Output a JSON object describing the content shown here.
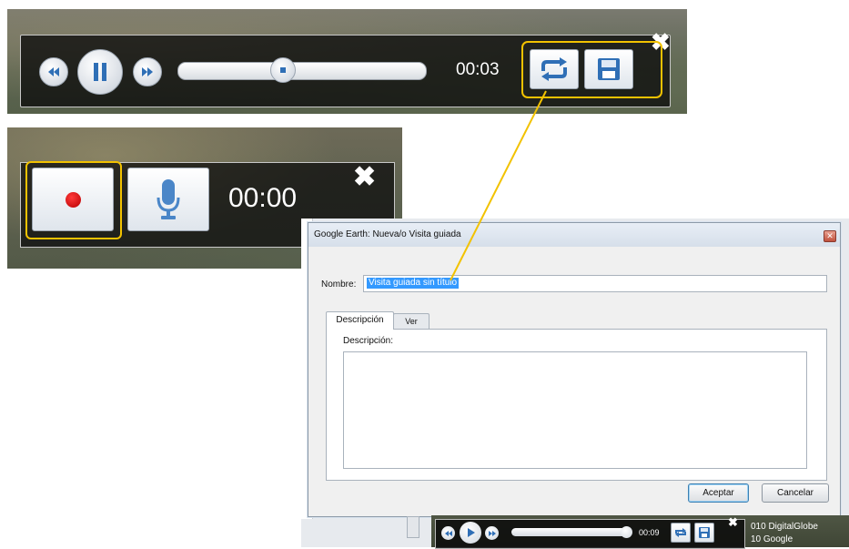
{
  "colors": {
    "highlight": "#f2c200",
    "accent_icon": "#2f6fb6",
    "record_red": "#c40000",
    "selection": "#3399ff"
  },
  "tour_player": {
    "time": "00:03",
    "progress": 0.4,
    "icons": [
      "rewind-icon",
      "pause-icon",
      "fast-forward-icon",
      "repeat-icon",
      "save-icon",
      "close-icon"
    ],
    "close_glyph": "✖"
  },
  "record_panel": {
    "time": "00:00",
    "icons": [
      "record-icon",
      "microphone-icon",
      "close-icon"
    ],
    "close_glyph": "✖"
  },
  "dialog": {
    "title": "Google Earth: Nueva/o Visita guiada",
    "name_label": "Nombre:",
    "name_value": "Visita guiada sin título",
    "tabs": [
      {
        "label": "Descripción",
        "active": true
      },
      {
        "label": "Ver",
        "active": false
      }
    ],
    "description_label": "Descripción:",
    "description_value": "",
    "accept_label": "Aceptar",
    "cancel_label": "Cancelar",
    "close_glyph": "✕"
  },
  "mini_player": {
    "time": "00:09",
    "progress": 0.96,
    "close_glyph": "✖",
    "credits": [
      "010 DigitalGlobe",
      "10 Google"
    ]
  }
}
